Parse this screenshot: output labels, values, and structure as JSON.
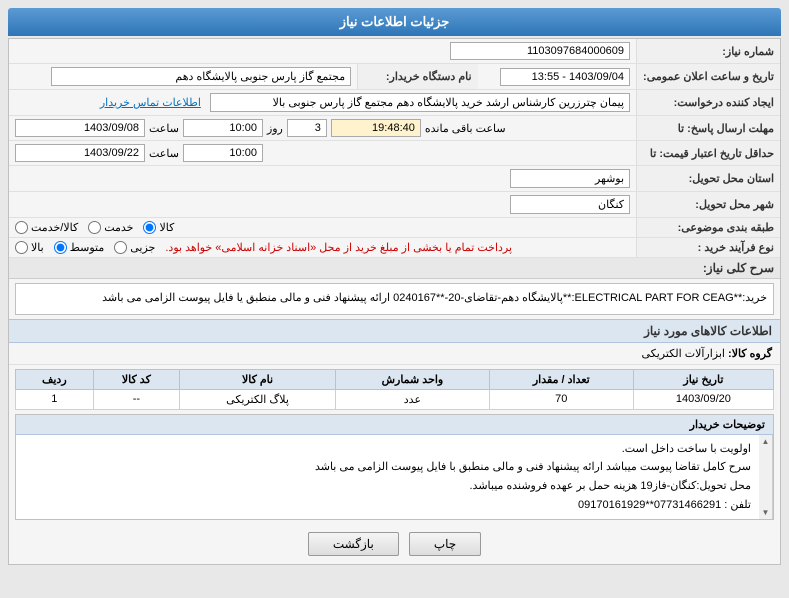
{
  "header": {
    "title": "جزئیات اطلاعات نیاز"
  },
  "fields": {
    "shomara_label": "شماره نیاز:",
    "shomara_value": "1103097684000609",
    "name_khardar_label": "نام دستگاه خریدار:",
    "name_khardar_value": "مجتمع گاز پارس جنوبی  پالایشگاه دهم",
    "idad_label": "ایجاد کننده درخواست:",
    "idad_value": "پیمان چترزرین کارشناس ارشد خرید پالایشگاه دهم مجتمع گاز پارس جنوبی  بالا",
    "idad_link": "اطلاعات تماس خریدار",
    "mohlat_label": "مهلت ارسال پاسخ: تا",
    "mohlat_date": "1403/09/08",
    "mohlat_time": "10:00",
    "mohlat_roz": "3",
    "mohlat_baqi": "19:48:40",
    "mohlat_baqi_label": "ساعت باقی مانده",
    "jadval_label": "حداقل تاریخ اعتبار قیمت: تا",
    "jadval_date": "1403/09/22",
    "jadval_time": "10:00",
    "ostan_label": "استان محل تحویل:",
    "ostan_value": "بوشهر",
    "shahr_label": "شهر محل تحویل:",
    "shahr_value": "کنگان",
    "tabaghe_label": "طبقه بندی موضوعی:",
    "tabaghe_options": [
      "کالا",
      "خدمت",
      "کالا/خدمت"
    ],
    "tabaghe_selected": "کالا",
    "nogh_label": "نوع فرآیند خرید :",
    "nogh_options": [
      "جزیی",
      "متوسط",
      "بالا"
    ],
    "nogh_desc": "پرداخت تمام یا بخشی از مبلغ خرید از محل «اسناد خزانه اسلامی» خواهد بود.",
    "tarikh_aelam_label": "تاریخ و ساعت اعلان عمومی:",
    "tarikh_aelam_value": "1403/09/04 - 13:55",
    "sarh_label": "سرح کلی نیاز:",
    "sarh_value": "خرید:**ELECTRICAL PART FOR CEAG:**پالایشگاه دهم-تقاضای-20-**0240167 ارائه پیشنهاد فنی و مالی منطبق یا فایل پیوست الزامی می باشد",
    "kalaha_label": "اطلاعات کالاهای مورد نیاز",
    "group_label": "گروه کالا:",
    "group_value": "ابزارآلات الکتریکی",
    "table_headers": [
      "ردیف",
      "کد کالا",
      "نام کالا",
      "واحد شمارش",
      "تعداد / مقدار",
      "تاریخ نیاز"
    ],
    "table_rows": [
      {
        "radif": "1",
        "kod": "--",
        "name": "پلاگ الکتریکی",
        "vahed": "عدد",
        "tedad": "70",
        "tarikh": "1403/09/20"
      }
    ],
    "tozi_label": "توضیحات خریدار",
    "tozi_lines": [
      "اولویت با ساخت داخل است.",
      "سرح کامل تقاضا پیوست میباشد ارائه پیشنهاد فنی و مالی منطبق با فایل پیوست الزامی می باشد",
      "محل تحویل:کنگان-فاز19 هزینه حمل بر عهده فروشنده میباشد.",
      "تلفن : 07731466291**09170161929"
    ],
    "btn_chap": "چاپ",
    "btn_bazgasht": "بازگشت"
  }
}
